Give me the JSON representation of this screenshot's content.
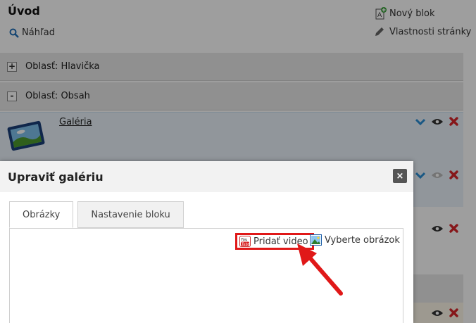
{
  "page": {
    "title": "Úvod",
    "preview_label": "Náhľad",
    "new_block_label": "Nový blok",
    "page_props_label": "Vlastnosti stránky"
  },
  "areas": [
    {
      "toggle": "+",
      "label": "Oblasť: Hlavička"
    },
    {
      "toggle": "-",
      "label": "Oblasť: Obsah"
    }
  ],
  "blocks": [
    {
      "name": "Galéria"
    }
  ],
  "modal": {
    "title": "Upraviť galériu",
    "close_label": "×",
    "tabs": [
      {
        "label": "Obrázky",
        "active": true
      },
      {
        "label": "Nastavenie bloku",
        "active": false
      }
    ],
    "toolbar": {
      "add_video_label": "Pridať video",
      "select_image_label": "Vyberte obrázok"
    }
  },
  "colors": {
    "highlight_red": "#e01818",
    "chevron_blue": "#2b8ed6",
    "delete_red": "#d9262b",
    "block_bg": "#eaf3fb"
  },
  "icons": [
    "search-icon",
    "new-block-icon",
    "pencil-icon",
    "chevron-down-icon",
    "eye-icon",
    "delete-icon",
    "youtube-icon",
    "image-icon",
    "close-icon",
    "arrow-annotation"
  ]
}
